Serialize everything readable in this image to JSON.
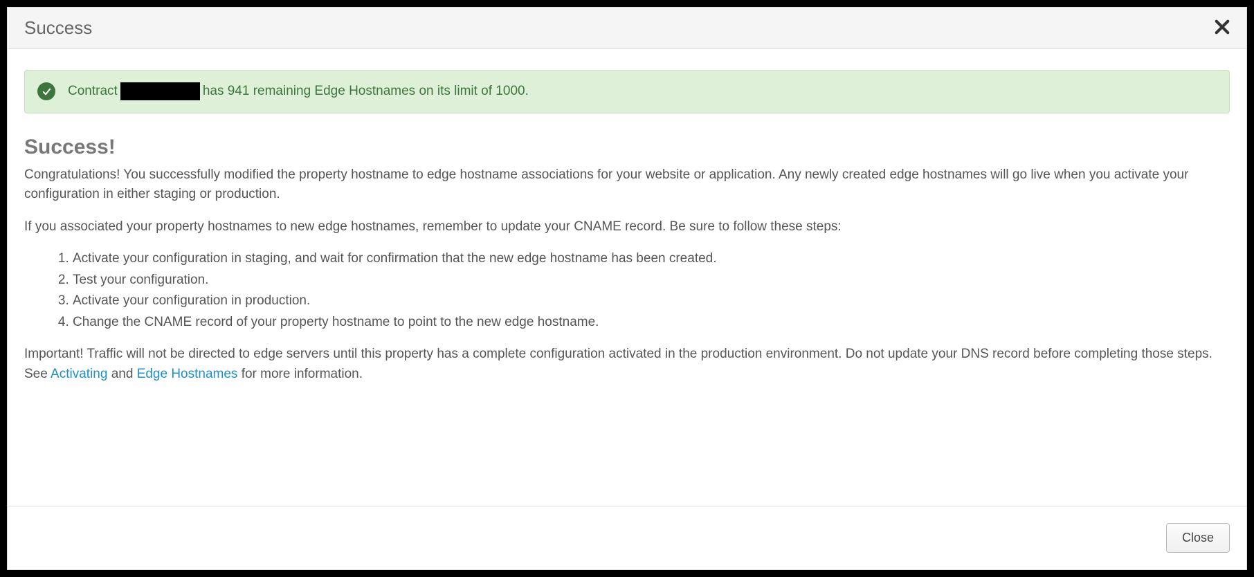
{
  "header": {
    "title": "Success"
  },
  "alert": {
    "prefix": "Contract",
    "suffix": "has 941 remaining Edge Hostnames on its limit of 1000."
  },
  "content": {
    "heading": "Success!",
    "para1": "Congratulations! You successfully modified the property hostname to edge hostname associations for your website or application. Any newly created edge hostnames will go live when you activate your configuration in either staging or production.",
    "para2": "If you associated your property hostnames to new edge hostnames, remember to update your CNAME record. Be sure to follow these steps:",
    "steps": [
      "Activate your configuration in staging, and wait for confirmation that the new edge hostname has been created.",
      "Test your configuration.",
      "Activate your configuration in production.",
      "Change the CNAME record of your property hostname to point to the new edge hostname."
    ],
    "important_pre": "Important! Traffic will not be directed to edge servers until this property has a complete configuration activated in the production environment. Do not update your DNS record before completing those steps. See ",
    "link1": "Activating",
    "important_mid": " and ",
    "link2": "Edge Hostnames",
    "important_post": " for more information."
  },
  "footer": {
    "close_label": "Close"
  }
}
